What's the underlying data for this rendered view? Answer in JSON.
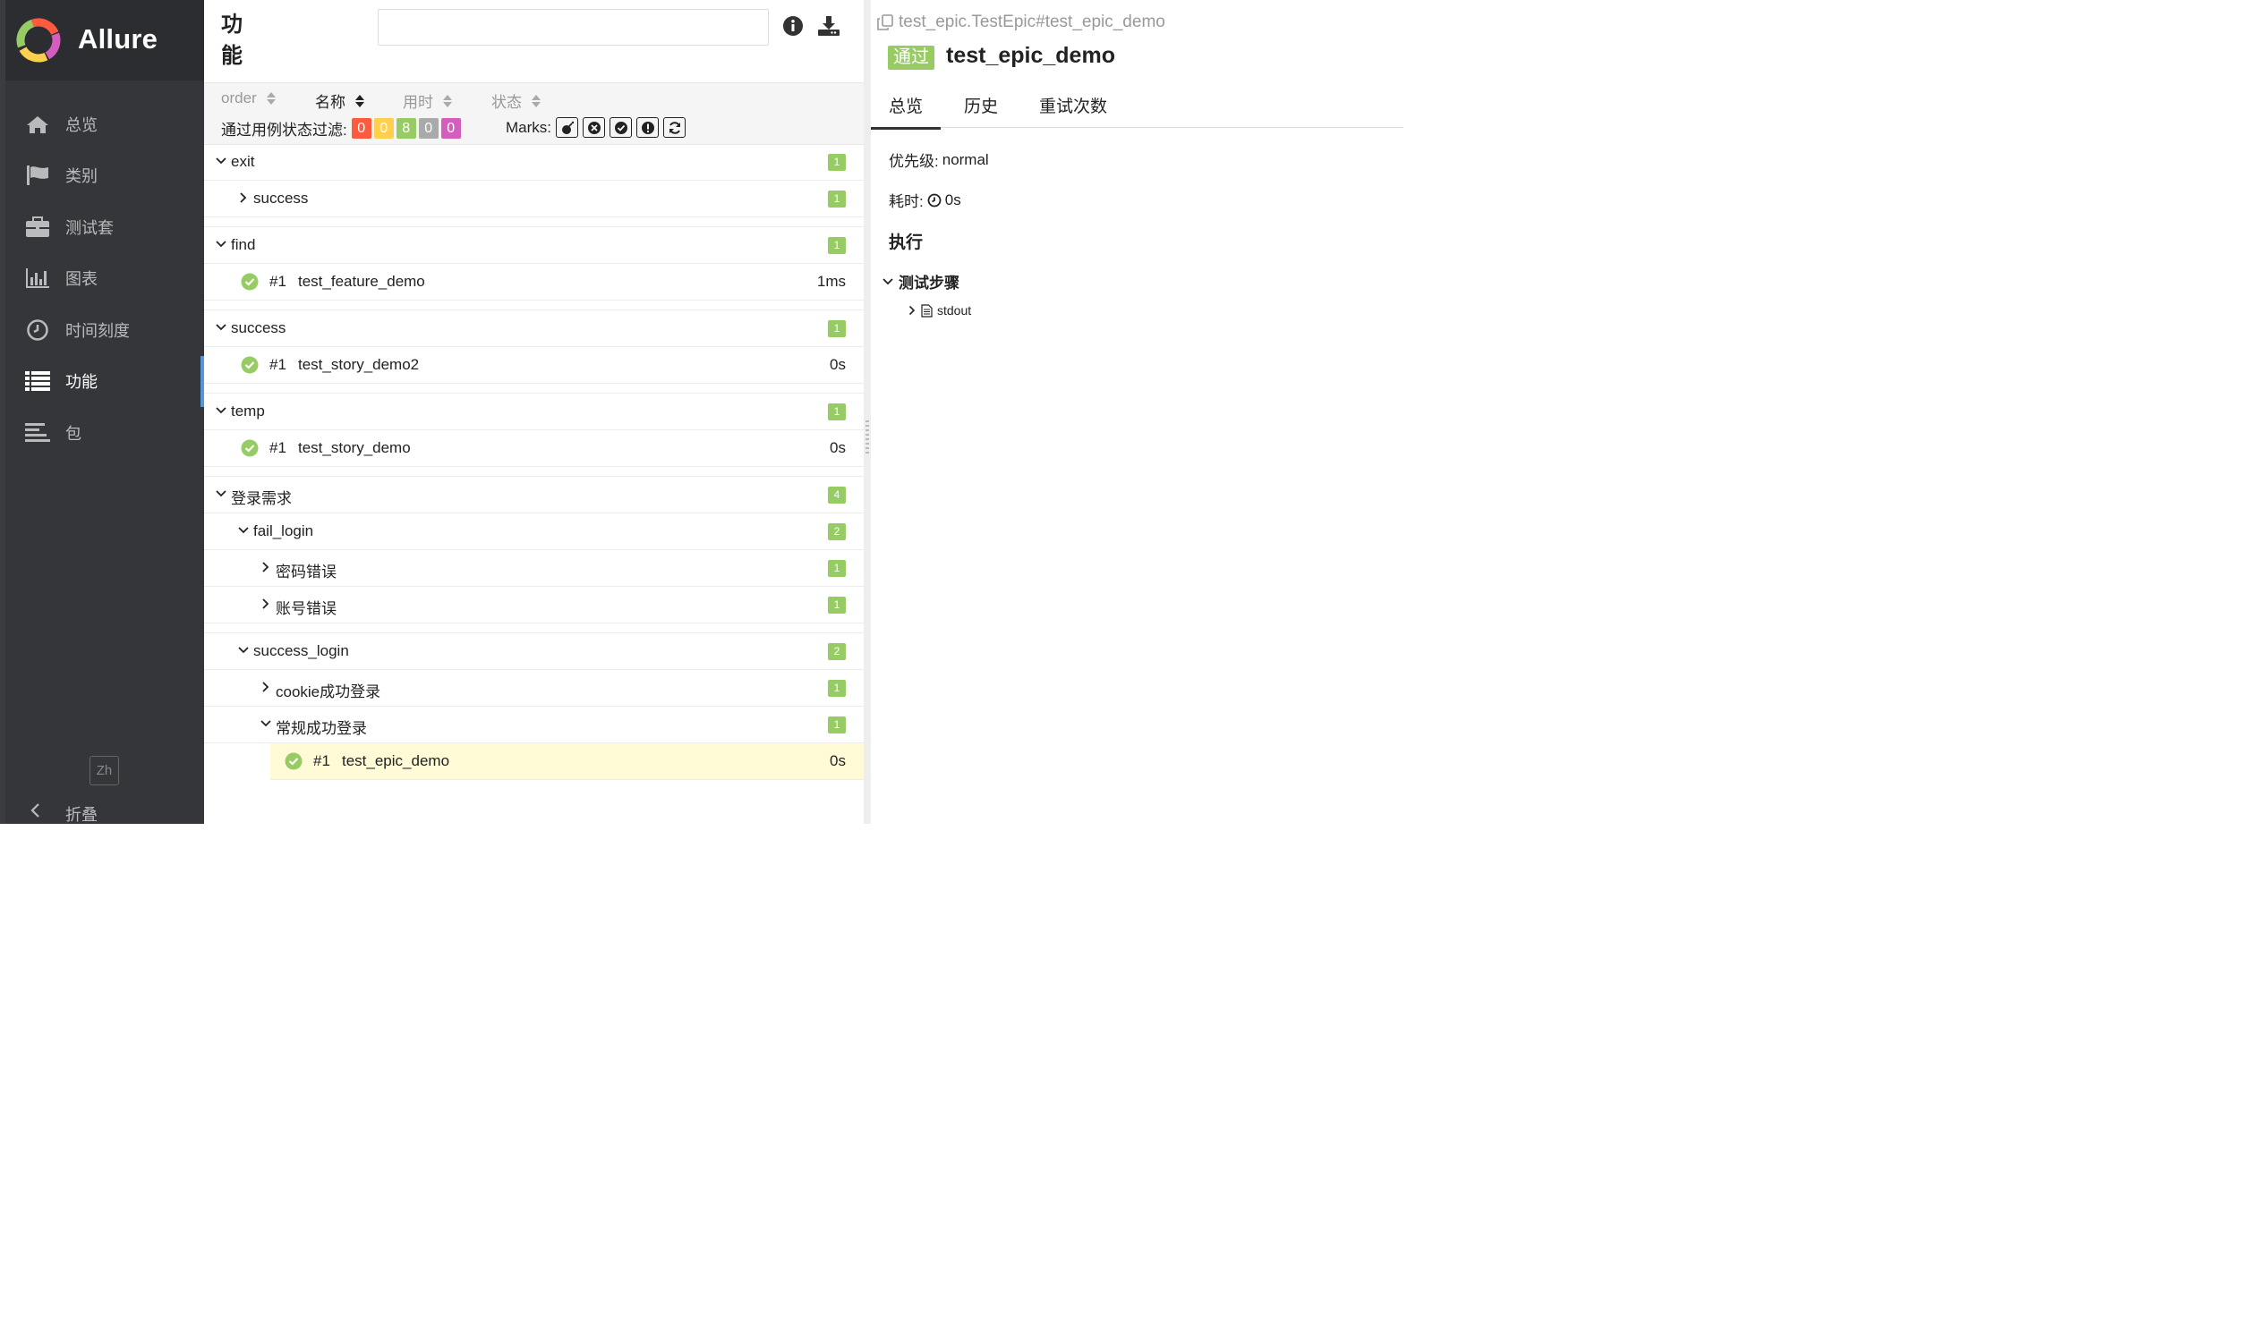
{
  "colors": {
    "sidebar_bg": "#343639",
    "brand_bg": "#2b2d30",
    "active_indicator": "#5596d6",
    "passed": "#97cc64",
    "failed": "#fd5a3e",
    "broken": "#ffd050",
    "skipped": "#aaaaaa",
    "unknown": "#d35ebe",
    "selected_row": "#fffbd6"
  },
  "sidebar": {
    "brand": "Allure",
    "items": [
      {
        "label": "总览",
        "icon": "home-icon"
      },
      {
        "label": "类别",
        "icon": "flag-icon"
      },
      {
        "label": "测试套",
        "icon": "briefcase-icon"
      },
      {
        "label": "图表",
        "icon": "bar-chart-icon"
      },
      {
        "label": "时间刻度",
        "icon": "clock-icon"
      },
      {
        "label": "功能",
        "icon": "list-icon",
        "active": true
      },
      {
        "label": "包",
        "icon": "align-left-icon"
      }
    ],
    "language": "Zh",
    "collapse": "折叠"
  },
  "middle": {
    "title": "功能",
    "search_placeholder": "",
    "sort": {
      "order": "order",
      "name": "名称",
      "duration": "用时",
      "status": "状态"
    },
    "filter": {
      "label": "通过用例状态过滤:",
      "counts": {
        "failed": "0",
        "broken": "0",
        "passed": "8",
        "skipped": "0",
        "unknown": "0"
      }
    },
    "marks_label": "Marks:",
    "tree": {
      "exit": {
        "name": "exit",
        "count": "1",
        "child": {
          "name": "success",
          "count": "1"
        }
      },
      "find": {
        "name": "find",
        "count": "1",
        "test": {
          "num": "#1",
          "name": "test_feature_demo",
          "duration": "1ms"
        }
      },
      "success": {
        "name": "success",
        "count": "1",
        "test": {
          "num": "#1",
          "name": "test_story_demo2",
          "duration": "0s"
        }
      },
      "temp": {
        "name": "temp",
        "count": "1",
        "test": {
          "num": "#1",
          "name": "test_story_demo",
          "duration": "0s"
        }
      },
      "login": {
        "name": "登录需求",
        "count": "4",
        "fail_login": {
          "name": "fail_login",
          "count": "2",
          "children": [
            {
              "name": "密码错误",
              "count": "1"
            },
            {
              "name": "账号错误",
              "count": "1"
            }
          ]
        },
        "success_login": {
          "name": "success_login",
          "count": "2",
          "cookie": {
            "name": "cookie成功登录",
            "count": "1"
          },
          "normal": {
            "name": "常规成功登录",
            "count": "1",
            "test": {
              "num": "#1",
              "name": "test_epic_demo",
              "duration": "0s"
            }
          }
        }
      }
    }
  },
  "right": {
    "breadcrumb": "test_epic.TestEpic#test_epic_demo",
    "status": "通过",
    "title": "test_epic_demo",
    "tabs": [
      "总览",
      "历史",
      "重试次数"
    ],
    "severity_label": "优先级:",
    "severity_value": "normal",
    "duration_label": "耗时:",
    "duration_value": "0s",
    "execution_title": "执行",
    "steps_title": "测试步骤",
    "attachment": "stdout"
  }
}
